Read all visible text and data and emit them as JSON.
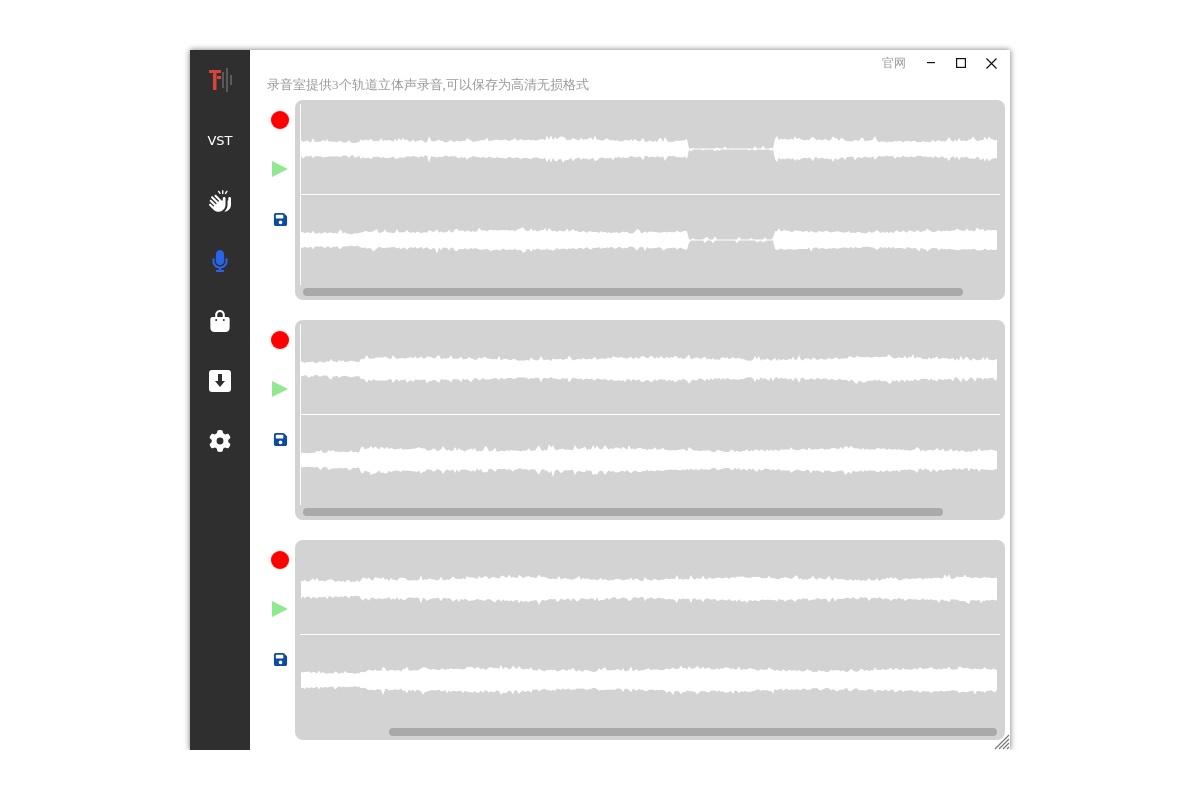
{
  "window": {
    "link": "官网"
  },
  "sidebar": {
    "items": [
      {
        "kind": "logo"
      },
      {
        "kind": "text",
        "label": "VST",
        "selected": false
      },
      {
        "kind": "clap",
        "selected": false
      },
      {
        "kind": "mic",
        "selected": true
      },
      {
        "kind": "bag",
        "selected": false
      },
      {
        "kind": "download",
        "selected": false
      },
      {
        "kind": "settings",
        "selected": false
      }
    ]
  },
  "description": "录音室提供3个轨道立体声录音,可以保存为高清无损格式",
  "tracks": [
    {
      "kind": "stereo"
    },
    {
      "kind": "stereo"
    },
    {
      "kind": "stereo"
    }
  ]
}
